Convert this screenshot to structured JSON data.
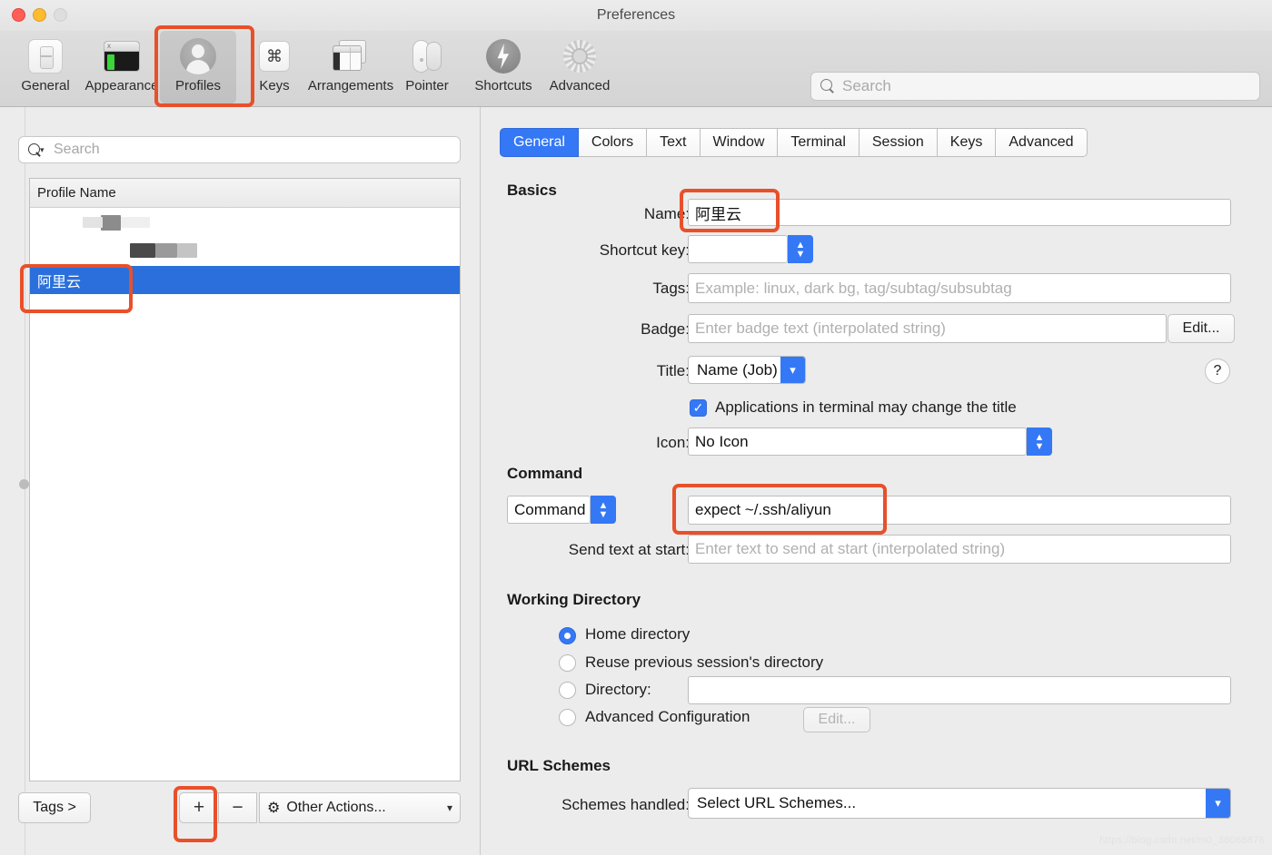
{
  "window": {
    "title": "Preferences"
  },
  "toolbar": {
    "items": [
      {
        "label": "General",
        "icon": "general-icon"
      },
      {
        "label": "Appearance",
        "icon": "appearance-icon"
      },
      {
        "label": "Profiles",
        "icon": "profiles-icon"
      },
      {
        "label": "Keys",
        "icon": "command-key-icon"
      },
      {
        "label": "Arrangements",
        "icon": "windows-icon"
      },
      {
        "label": "Pointer",
        "icon": "mouse-icon"
      },
      {
        "label": "Shortcuts",
        "icon": "bolt-icon"
      },
      {
        "label": "Advanced",
        "icon": "gear-icon"
      }
    ],
    "selected": "Profiles",
    "search_placeholder": "Search"
  },
  "sidebar": {
    "search_placeholder": "Search",
    "column_header": "Profile Name",
    "rows": [
      {
        "label": "",
        "redacted": true,
        "selected": false
      },
      {
        "label": "",
        "redacted": true,
        "selected": false
      },
      {
        "label": "阿里云",
        "redacted": false,
        "selected": true
      }
    ],
    "tags_button": "Tags >",
    "add_button": "+",
    "remove_button": "−",
    "other_actions": "Other Actions...",
    "other_actions_icon": "gear-icon",
    "other_actions_chevron": "chevron-down-icon"
  },
  "tabs": [
    {
      "label": "General",
      "active": true
    },
    {
      "label": "Colors",
      "active": false
    },
    {
      "label": "Text",
      "active": false
    },
    {
      "label": "Window",
      "active": false
    },
    {
      "label": "Terminal",
      "active": false
    },
    {
      "label": "Session",
      "active": false
    },
    {
      "label": "Keys",
      "active": false
    },
    {
      "label": "Advanced",
      "active": false
    }
  ],
  "general": {
    "basics_title": "Basics",
    "name_label": "Name:",
    "name_value": "阿里云",
    "shortcut_label": "Shortcut key:",
    "shortcut_value": "",
    "tags_label": "Tags:",
    "tags_placeholder": "Example: linux, dark bg, tag/subtag/subsubtag",
    "badge_label": "Badge:",
    "badge_placeholder": "Enter badge text (interpolated string)",
    "badge_edit_button": "Edit...",
    "title_label": "Title:",
    "title_value": "Name (Job)",
    "help_button": "?",
    "app_title_checkbox_label": "Applications in terminal may change the title",
    "app_title_checked": true,
    "icon_label": "Icon:",
    "icon_value": "No Icon",
    "command_title": "Command",
    "command_type": "Command",
    "command_value": "expect ~/.ssh/aliyun",
    "send_text_label": "Send text at start:",
    "send_text_placeholder": "Enter text to send at start (interpolated string)",
    "working_dir_title": "Working Directory",
    "wd_home": "Home directory",
    "wd_reuse": "Reuse previous session's directory",
    "wd_directory": "Directory:",
    "wd_directory_value": "",
    "wd_advanced": "Advanced Configuration",
    "wd_advanced_edit": "Edit...",
    "wd_selected": "Home directory",
    "url_schemes_title": "URL Schemes",
    "schemes_label": "Schemes handled:",
    "schemes_value": "Select URL Schemes..."
  },
  "watermark": "https://blog.csdn.net/m0_38068876",
  "colors": {
    "accent": "#3478f6",
    "selection": "#2a6fdb",
    "annotation": "#e8502a"
  }
}
